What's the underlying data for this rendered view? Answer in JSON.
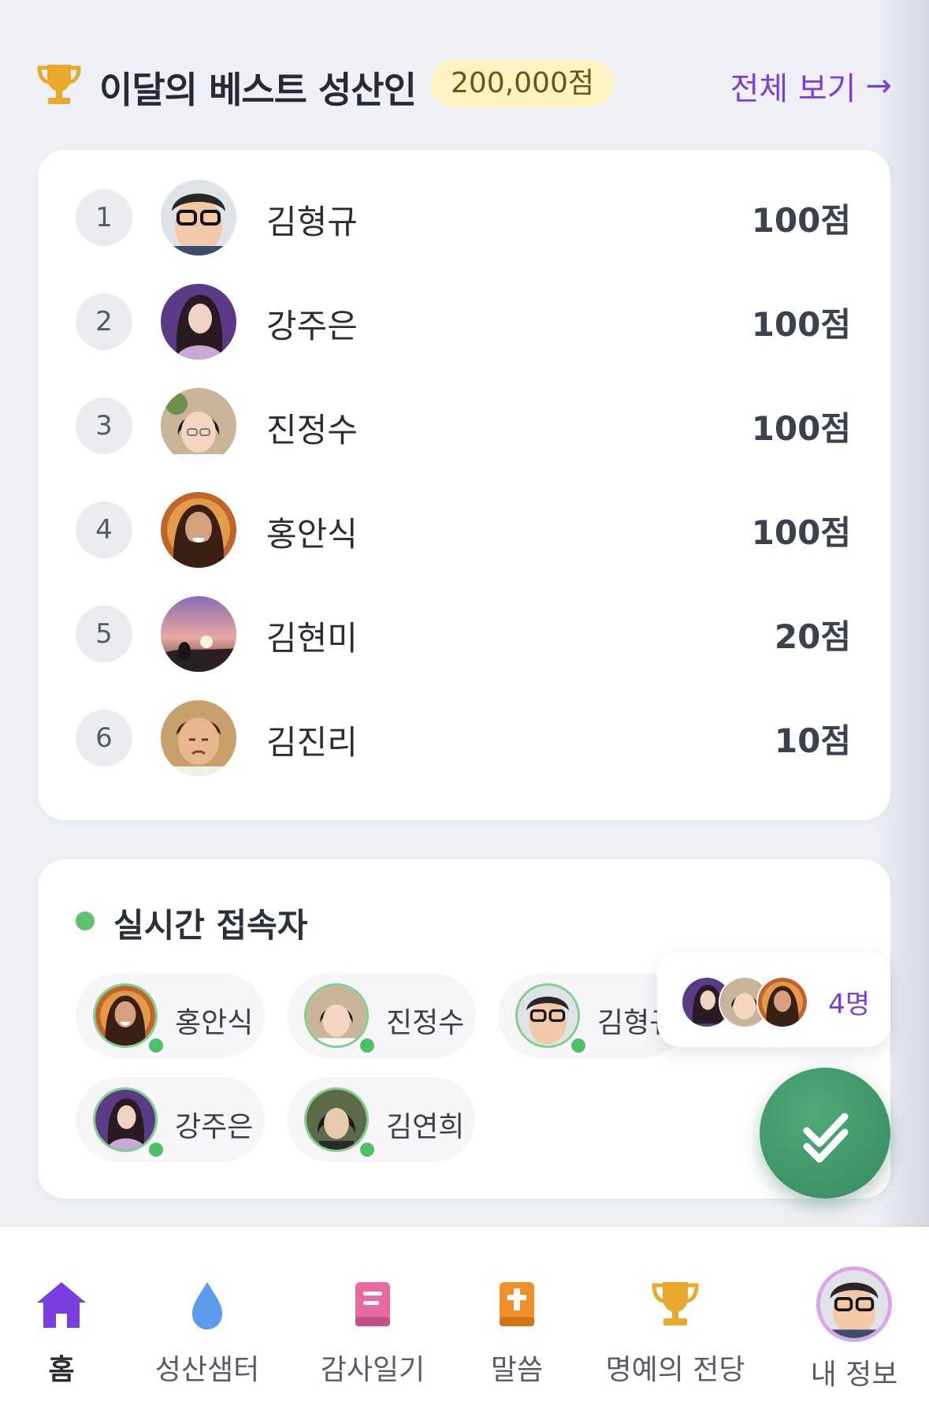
{
  "header": {
    "title": "이달의 베스트 성산인",
    "prize": "200,000점",
    "view_all": "전체 보기",
    "view_all_arrow": "→"
  },
  "ranking": [
    {
      "rank": "1",
      "name": "김형규",
      "score": "100점"
    },
    {
      "rank": "2",
      "name": "강주은",
      "score": "100점"
    },
    {
      "rank": "3",
      "name": "진정수",
      "score": "100점"
    },
    {
      "rank": "4",
      "name": "홍안식",
      "score": "100점"
    },
    {
      "rank": "5",
      "name": "김현미",
      "score": "20점"
    },
    {
      "rank": "6",
      "name": "김진리",
      "score": "10점"
    }
  ],
  "online": {
    "title": "실시간 접속자",
    "users": [
      {
        "name": "홍안식"
      },
      {
        "name": "진정수"
      },
      {
        "name": "김형규"
      },
      {
        "name": "강주은"
      },
      {
        "name": "김연희"
      }
    ],
    "popup_count": "4명"
  },
  "nav": [
    {
      "label": "홈",
      "icon": "home-icon"
    },
    {
      "label": "성산샘터",
      "icon": "water-drop-icon"
    },
    {
      "label": "감사일기",
      "icon": "journal-icon"
    },
    {
      "label": "말씀",
      "icon": "bible-icon"
    },
    {
      "label": "명예의 전당",
      "icon": "trophy-icon"
    },
    {
      "label": "내 정보",
      "icon": "profile-avatar"
    }
  ],
  "colors": {
    "accent": "#7a3ee0",
    "online_green": "#5ec26e",
    "fab_green": "#3f9a6a",
    "trophy_gold": "#e8a92c",
    "prize_bg": "#fdf3c2"
  }
}
